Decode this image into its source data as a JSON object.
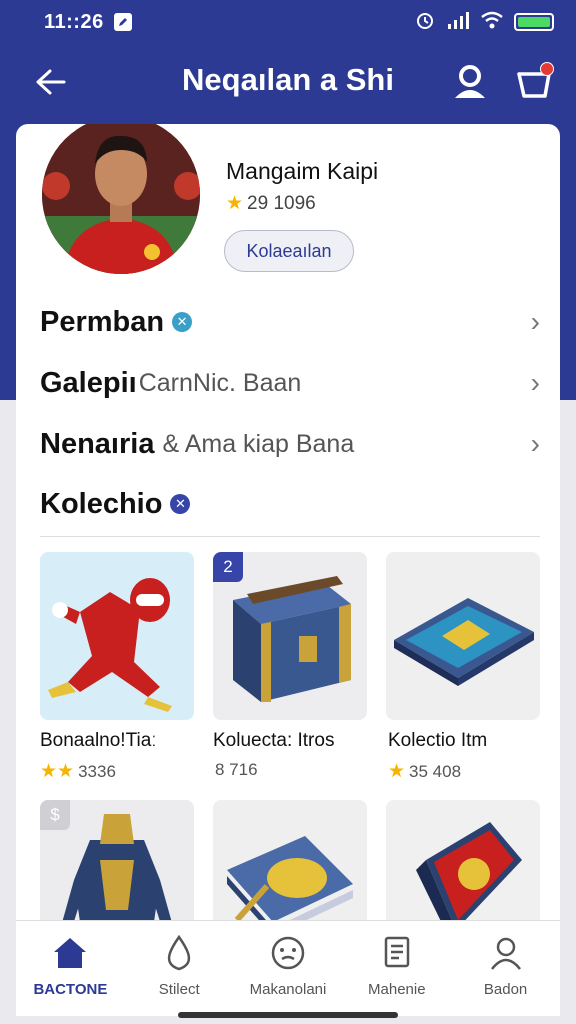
{
  "status_bar": {
    "time": "11::26"
  },
  "app_bar": {
    "title": "Neqaılan a Shi"
  },
  "profile": {
    "name": "Mangaim Kaipi",
    "rating": "29 1096",
    "button_label": "Kolaeaılan"
  },
  "menu": [
    {
      "label": "Permban",
      "sub": "",
      "badge": "✕"
    },
    {
      "label": "Galepiı",
      "sub": "CarnNic. Baan",
      "badge": ""
    },
    {
      "label": "Nenaıria",
      "sub": "& Ama kiap Bana",
      "badge": ""
    }
  ],
  "collection": {
    "label": "Kolechio",
    "badge": "✕"
  },
  "items": [
    {
      "label": "Bonaalno!Tiaː",
      "meta": "3336",
      "tag": ""
    },
    {
      "label": "Koluecta: Itros",
      "meta": "8 716",
      "tag": "2"
    },
    {
      "label": "Kolectio Itm",
      "meta": "35 408",
      "tag": ""
    },
    {
      "label": "",
      "meta": "",
      "tag": "$"
    },
    {
      "label": "",
      "meta": "",
      "tag": ""
    },
    {
      "label": "",
      "meta": "",
      "tag": ""
    }
  ],
  "nav": [
    {
      "label": "BACTONE",
      "icon": "home-icon"
    },
    {
      "label": "Stilect",
      "icon": "flame-icon"
    },
    {
      "label": "Makanolani",
      "icon": "face-icon"
    },
    {
      "label": "Mahenie",
      "icon": "document-icon"
    },
    {
      "label": "Badon",
      "icon": "profile-icon"
    }
  ],
  "colors": {
    "brand": "#2c3a94",
    "rating_star": "#f4b400",
    "battery": "#4cd964",
    "badge": "#e53935"
  }
}
